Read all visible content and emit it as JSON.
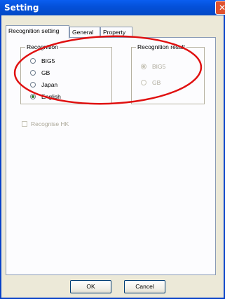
{
  "window": {
    "title": "Setting",
    "close_glyph": "✕"
  },
  "tabs": [
    {
      "label": "Recognition setting",
      "active": true
    },
    {
      "label": "General",
      "active": false
    },
    {
      "label": "Property",
      "active": false
    }
  ],
  "recognition": {
    "legend": "Recognition",
    "options": [
      {
        "label": "BIG5",
        "checked": false
      },
      {
        "label": "GB",
        "checked": false
      },
      {
        "label": "Japan",
        "checked": false
      },
      {
        "label": "English",
        "checked": true
      }
    ]
  },
  "recognition_result": {
    "legend": "Recognition result",
    "options": [
      {
        "label": "BIG5",
        "checked": true,
        "disabled": true
      },
      {
        "label": "GB",
        "checked": false,
        "disabled": true
      }
    ]
  },
  "recognise_hk": {
    "label": "Recognise HK",
    "checked": false,
    "disabled": true
  },
  "buttons": {
    "ok": "OK",
    "cancel": "Cancel"
  },
  "annotation": {
    "shape": "ellipse",
    "color": "#e01010"
  }
}
